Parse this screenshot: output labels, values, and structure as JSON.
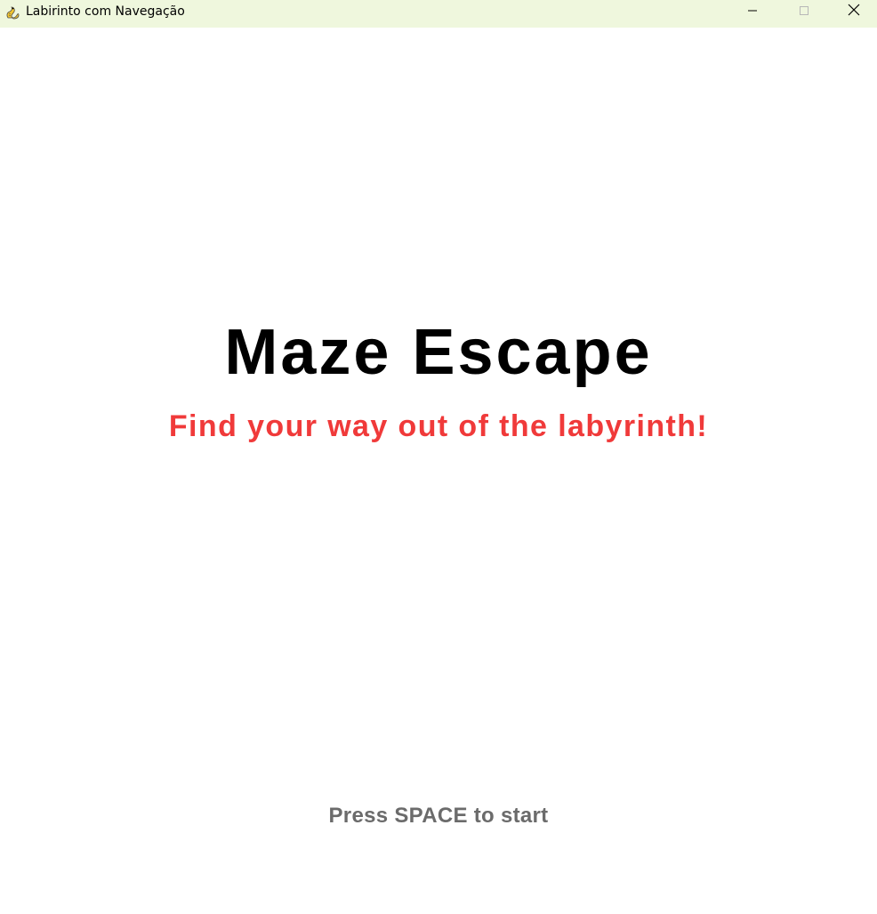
{
  "window": {
    "title": "Labirinto com Navegação",
    "icon": "pygame-snake-icon",
    "controls": {
      "minimize_icon": "minimize-icon",
      "maximize_icon": "maximize-icon",
      "close_icon": "close-icon"
    },
    "titlebar_color": "#eff7dd"
  },
  "screen": {
    "title": "Maze Escape",
    "subtitle": "Find your way out of the labyrinth!",
    "prompt": "Press SPACE to start",
    "colors": {
      "background": "#ffffff",
      "title": "#000000",
      "subtitle": "#f03a3a",
      "prompt": "#6b6b6b"
    }
  }
}
